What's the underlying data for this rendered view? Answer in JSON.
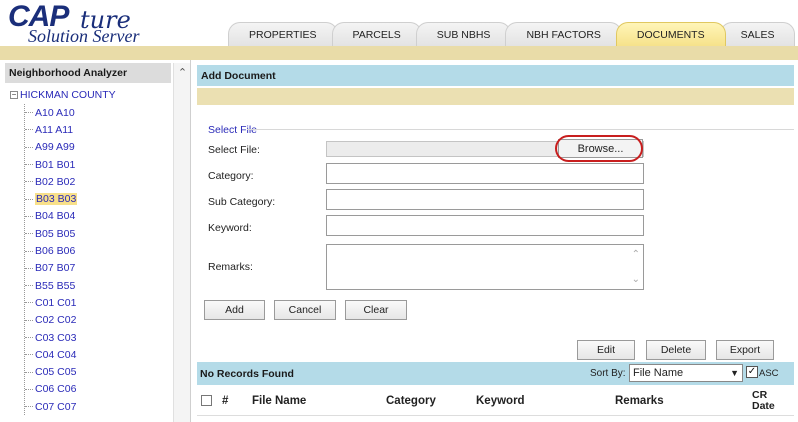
{
  "app": {
    "logo_main": "CAP",
    "logo_script": "ture",
    "logo_sub": "Solution Server"
  },
  "tabs": [
    {
      "label": "PROPERTIES",
      "active": false
    },
    {
      "label": "PARCELS",
      "active": false
    },
    {
      "label": "SUB NBHS",
      "active": false
    },
    {
      "label": "NBH FACTORS",
      "active": false
    },
    {
      "label": "DOCUMENTS",
      "active": true
    },
    {
      "label": "SALES",
      "active": false
    }
  ],
  "left": {
    "title": "Neighborhood Analyzer",
    "root_toggle": "−",
    "root_label": "HICKMAN COUNTY",
    "items": [
      {
        "label": "A10 A10",
        "selected": false
      },
      {
        "label": "A11 A11",
        "selected": false
      },
      {
        "label": "A99 A99",
        "selected": false
      },
      {
        "label": "B01 B01",
        "selected": false
      },
      {
        "label": "B02 B02",
        "selected": false
      },
      {
        "label": "B03 B03",
        "selected": true
      },
      {
        "label": "B04 B04",
        "selected": false
      },
      {
        "label": "B05 B05",
        "selected": false
      },
      {
        "label": "B06 B06",
        "selected": false
      },
      {
        "label": "B07 B07",
        "selected": false
      },
      {
        "label": "B55 B55",
        "selected": false
      },
      {
        "label": "C01 C01",
        "selected": false
      },
      {
        "label": "C02 C02",
        "selected": false
      },
      {
        "label": "C03 C03",
        "selected": false
      },
      {
        "label": "C04 C04",
        "selected": false
      },
      {
        "label": "C05 C05",
        "selected": false
      },
      {
        "label": "C06 C06",
        "selected": false
      },
      {
        "label": "C07 C07",
        "selected": false
      }
    ]
  },
  "form": {
    "header": "Add Document",
    "legend": "Select File",
    "select_file_label": "Select File:",
    "browse_label": "Browse...",
    "category_label": "Category:",
    "category_value": "",
    "subcategory_label": "Sub Category:",
    "subcategory_value": "",
    "keyword_label": "Keyword:",
    "keyword_value": "",
    "remarks_label": "Remarks:",
    "remarks_value": "",
    "add_label": "Add",
    "cancel_label": "Cancel",
    "clear_label": "Clear"
  },
  "actions": {
    "edit_label": "Edit",
    "delete_label": "Delete",
    "export_label": "Export"
  },
  "records": {
    "status": "No Records Found",
    "sort_by_label": "Sort By:",
    "sort_by_value": "File Name",
    "asc_checked": true,
    "asc_label": "ASC",
    "columns": [
      "#",
      "File Name",
      "Category",
      "Keyword",
      "Remarks",
      "CR",
      "Date"
    ]
  },
  "colors": {
    "header_band": "#e9dca8",
    "section_blue": "#b4dbe8",
    "link_blue": "#2a2ab8",
    "active_tab": "#f6e28a",
    "highlight_ring": "#c81e1e"
  }
}
